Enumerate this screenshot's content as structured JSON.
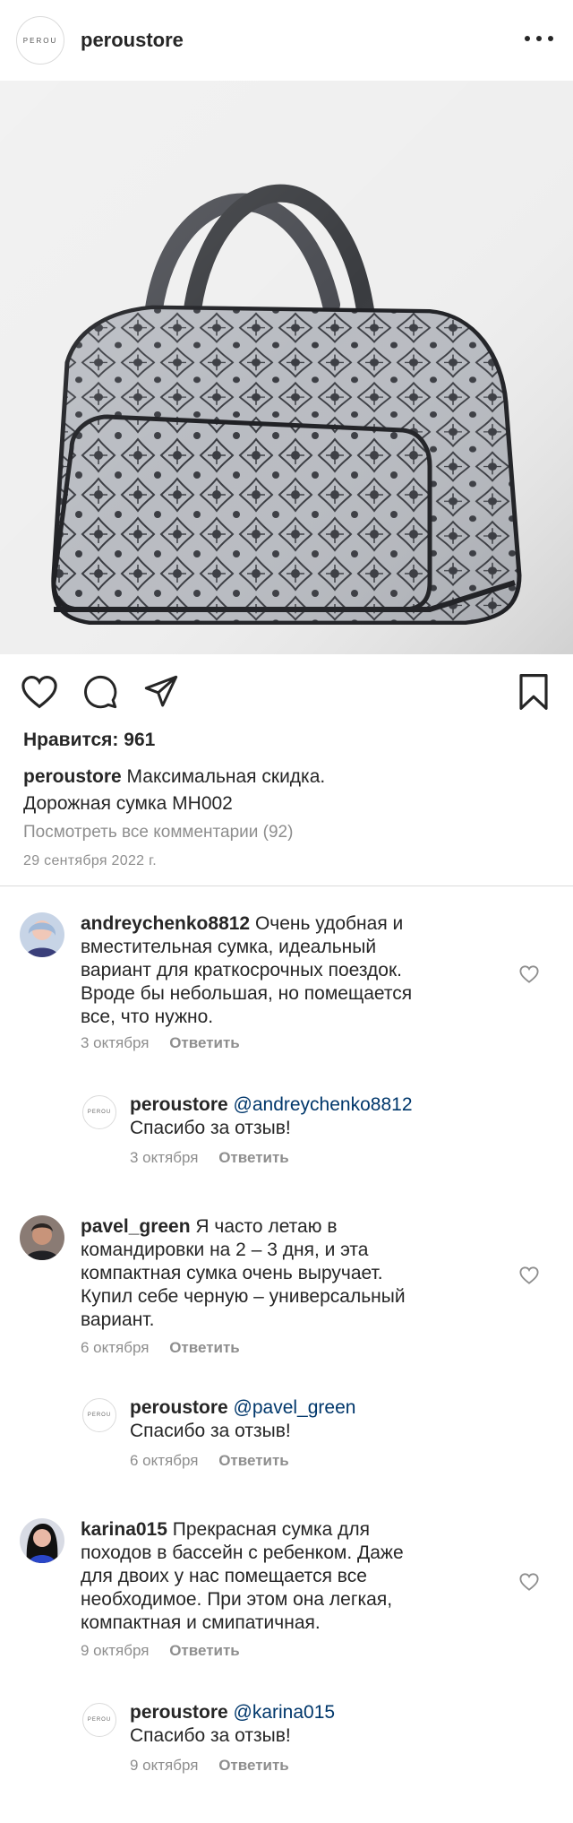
{
  "header": {
    "logo_text": "PEROU",
    "username": "peroustore"
  },
  "post": {
    "likes": "Нравится: 961",
    "caption_user": "peroustore",
    "caption_line1": "Максимальная скидка.",
    "caption_line2": "Дорожная сумка MH002",
    "view_all": "Посмотреть все комментарии (92)",
    "date": "29 сентября 2022 г."
  },
  "comments": [
    {
      "user": "andreychenko8812",
      "lines": [
        "Очень удобная и",
        "вместительная сумка, идеальный",
        "вариант для краткосрочных поездок.",
        "Вроде бы небольшая, но помещается",
        "все, что нужно."
      ],
      "date": "3 октября",
      "reply_label": "Ответить",
      "response": {
        "user": "peroustore",
        "mention": "@andreychenko8812",
        "text": "Спасибо за отзыв!",
        "date": "3 октября",
        "reply_label": "Ответить"
      }
    },
    {
      "user": "pavel_green",
      "lines": [
        "Я часто летаю в",
        "командировки на 2 – 3 дня, и эта",
        "компактная сумка очень выручает.",
        "Купил себе черную – универсальный",
        "вариант."
      ],
      "date": "6 октября",
      "reply_label": "Ответить",
      "response": {
        "user": "peroustore",
        "mention": "@pavel_green",
        "text": "Спасибо за отзыв!",
        "date": "6 октября",
        "reply_label": "Ответить"
      }
    },
    {
      "user": "karina015",
      "lines": [
        "Прекрасная сумка для",
        "походов в бассейн с ребенком. Даже",
        "для двоих у нас помещается все",
        "необходимое. При этом она легкая,",
        "компактная и смипатичная."
      ],
      "date": "9 октября",
      "reply_label": "Ответить",
      "response": {
        "user": "peroustore",
        "mention": "@karina015",
        "text": "Спасибо за отзыв!",
        "date": "9 октября",
        "reply_label": "Ответить"
      }
    }
  ],
  "icons": {
    "like": "heart-icon",
    "comment": "comment-icon",
    "share": "share-icon",
    "save": "bookmark-icon",
    "more": "more-icon"
  }
}
